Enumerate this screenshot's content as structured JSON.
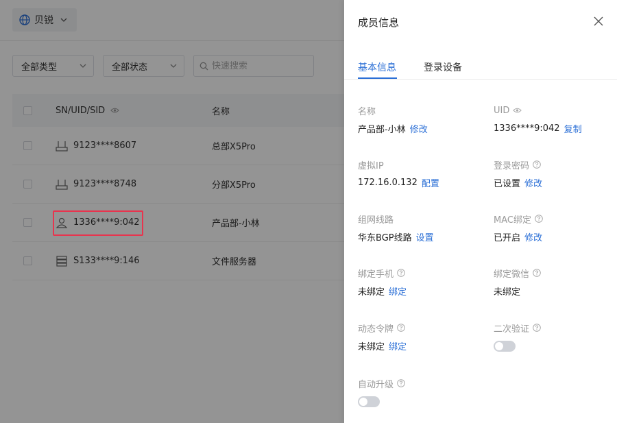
{
  "topbar": {
    "brand_label": "贝锐"
  },
  "filters": {
    "type_select": "全部类型",
    "status_select": "全部状态",
    "search_placeholder": "快速搜索"
  },
  "table": {
    "headers": {
      "id": "SN/UID/SID",
      "name": "名称"
    },
    "rows": [
      {
        "id": "9123****8607",
        "name": "总部X5Pro",
        "icon": "router-icon"
      },
      {
        "id": "9123****8748",
        "name": "分部X5Pro",
        "icon": "router-icon"
      },
      {
        "id": "1336****9:042",
        "name": "产品部-小林",
        "icon": "user-icon"
      },
      {
        "id": "S133****9:146",
        "name": "文件服务器",
        "icon": "server-icon"
      }
    ]
  },
  "drawer": {
    "title": "成员信息",
    "tabs": [
      {
        "label": "基本信息",
        "active": true
      },
      {
        "label": "登录设备",
        "active": false
      }
    ],
    "fields": {
      "name": {
        "label": "名称",
        "value": "产品部-小林",
        "action": "修改"
      },
      "uid": {
        "label": "UID",
        "value": "1336****9:042",
        "action": "复制"
      },
      "virtual_ip": {
        "label": "虚拟IP",
        "value": "172.16.0.132",
        "action": "配置"
      },
      "login_password": {
        "label": "登录密码",
        "value": "已设置",
        "action": "修改"
      },
      "network_line": {
        "label": "组网线路",
        "value": "华东BGP线路",
        "action": "设置"
      },
      "mac_binding": {
        "label": "MAC绑定",
        "value": "已开启",
        "action": "修改"
      },
      "bind_phone": {
        "label": "绑定手机",
        "value": "未绑定",
        "action": "绑定"
      },
      "bind_wechat": {
        "label": "绑定微信",
        "value": "未绑定"
      },
      "dynamic_token": {
        "label": "动态令牌",
        "value": "未绑定",
        "action": "绑定"
      },
      "two_factor": {
        "label": "二次验证",
        "enabled": false
      },
      "auto_upgrade": {
        "label": "自动升级",
        "enabled": false
      }
    }
  },
  "colors": {
    "accent": "#2b6fd6",
    "highlight": "#e8344e",
    "toggle_off": "#cfd2d8"
  }
}
